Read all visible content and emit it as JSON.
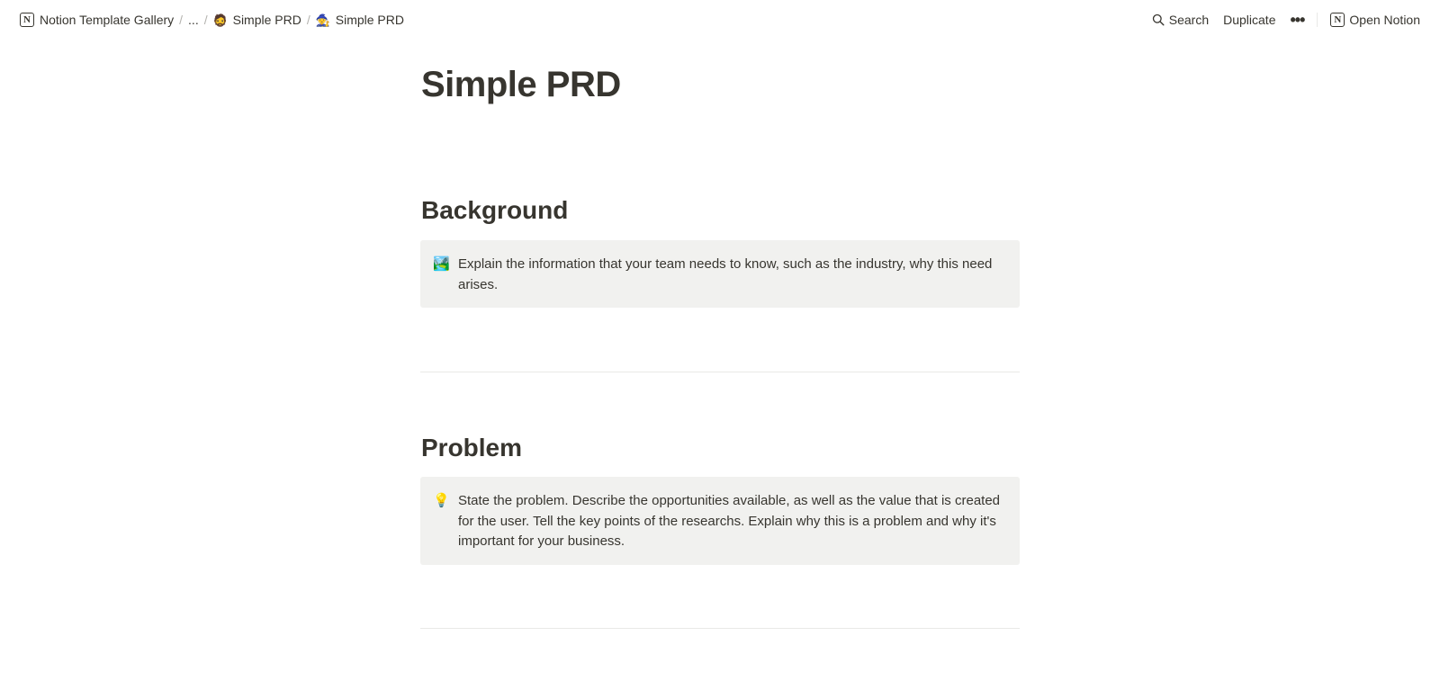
{
  "breadcrumb": {
    "items": [
      {
        "icon": "notion-logo-icon",
        "glyph": "N",
        "label": "Notion Template Gallery"
      },
      {
        "label": "..."
      },
      {
        "icon": "avatar-emoji-icon",
        "glyph": "🧔",
        "label": "Simple PRD"
      },
      {
        "icon": "page-emoji-icon",
        "glyph": "🧙",
        "label": "Simple PRD"
      }
    ],
    "separator": "/"
  },
  "topbar_actions": {
    "search_label": "Search",
    "duplicate_label": "Duplicate",
    "more_glyph": "•••",
    "open_notion_label": "Open Notion",
    "open_notion_glyph": "N"
  },
  "page": {
    "title": "Simple PRD",
    "sections": [
      {
        "heading": "Background",
        "callout_icon": "🏞️",
        "callout_text": "Explain the information that your team needs to know, such as the industry, why this need arises."
      },
      {
        "heading": "Problem",
        "callout_icon": "💡",
        "callout_text": "State the problem. Describe the opportunities available, as well as the value that is created for the user. Tell the key points of the researchs. Explain why this is a problem and why it's important for your business."
      }
    ]
  }
}
